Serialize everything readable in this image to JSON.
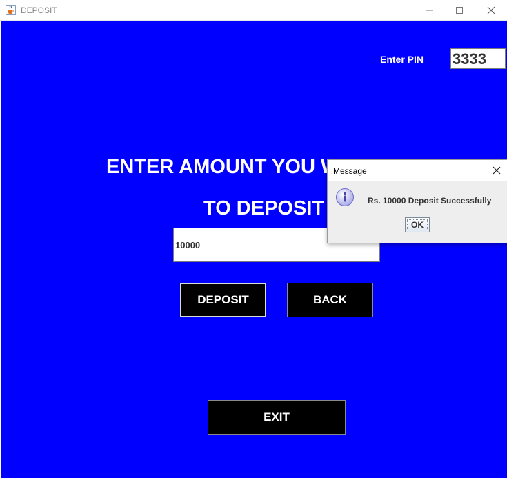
{
  "window": {
    "title": "DEPOSIT",
    "icon": "java-cup-icon",
    "controls": [
      "minimize-icon",
      "maximize-icon",
      "close-icon"
    ]
  },
  "pin": {
    "label": "Enter PIN",
    "value": "3333"
  },
  "prompt": {
    "line1": "ENTER AMOUNT YOU WANT",
    "line2": "TO DEPOSIT"
  },
  "amount_field": {
    "value": "10000"
  },
  "buttons": {
    "deposit": "DEPOSIT",
    "back": "BACK",
    "exit": "EXIT"
  },
  "dialog": {
    "title": "Message",
    "message": "Rs. 10000 Deposit Successfully",
    "ok_label": "OK",
    "icon": "info-icon"
  },
  "colors": {
    "background": "#0000ff",
    "button": "#000000",
    "text": "#ffffff"
  }
}
